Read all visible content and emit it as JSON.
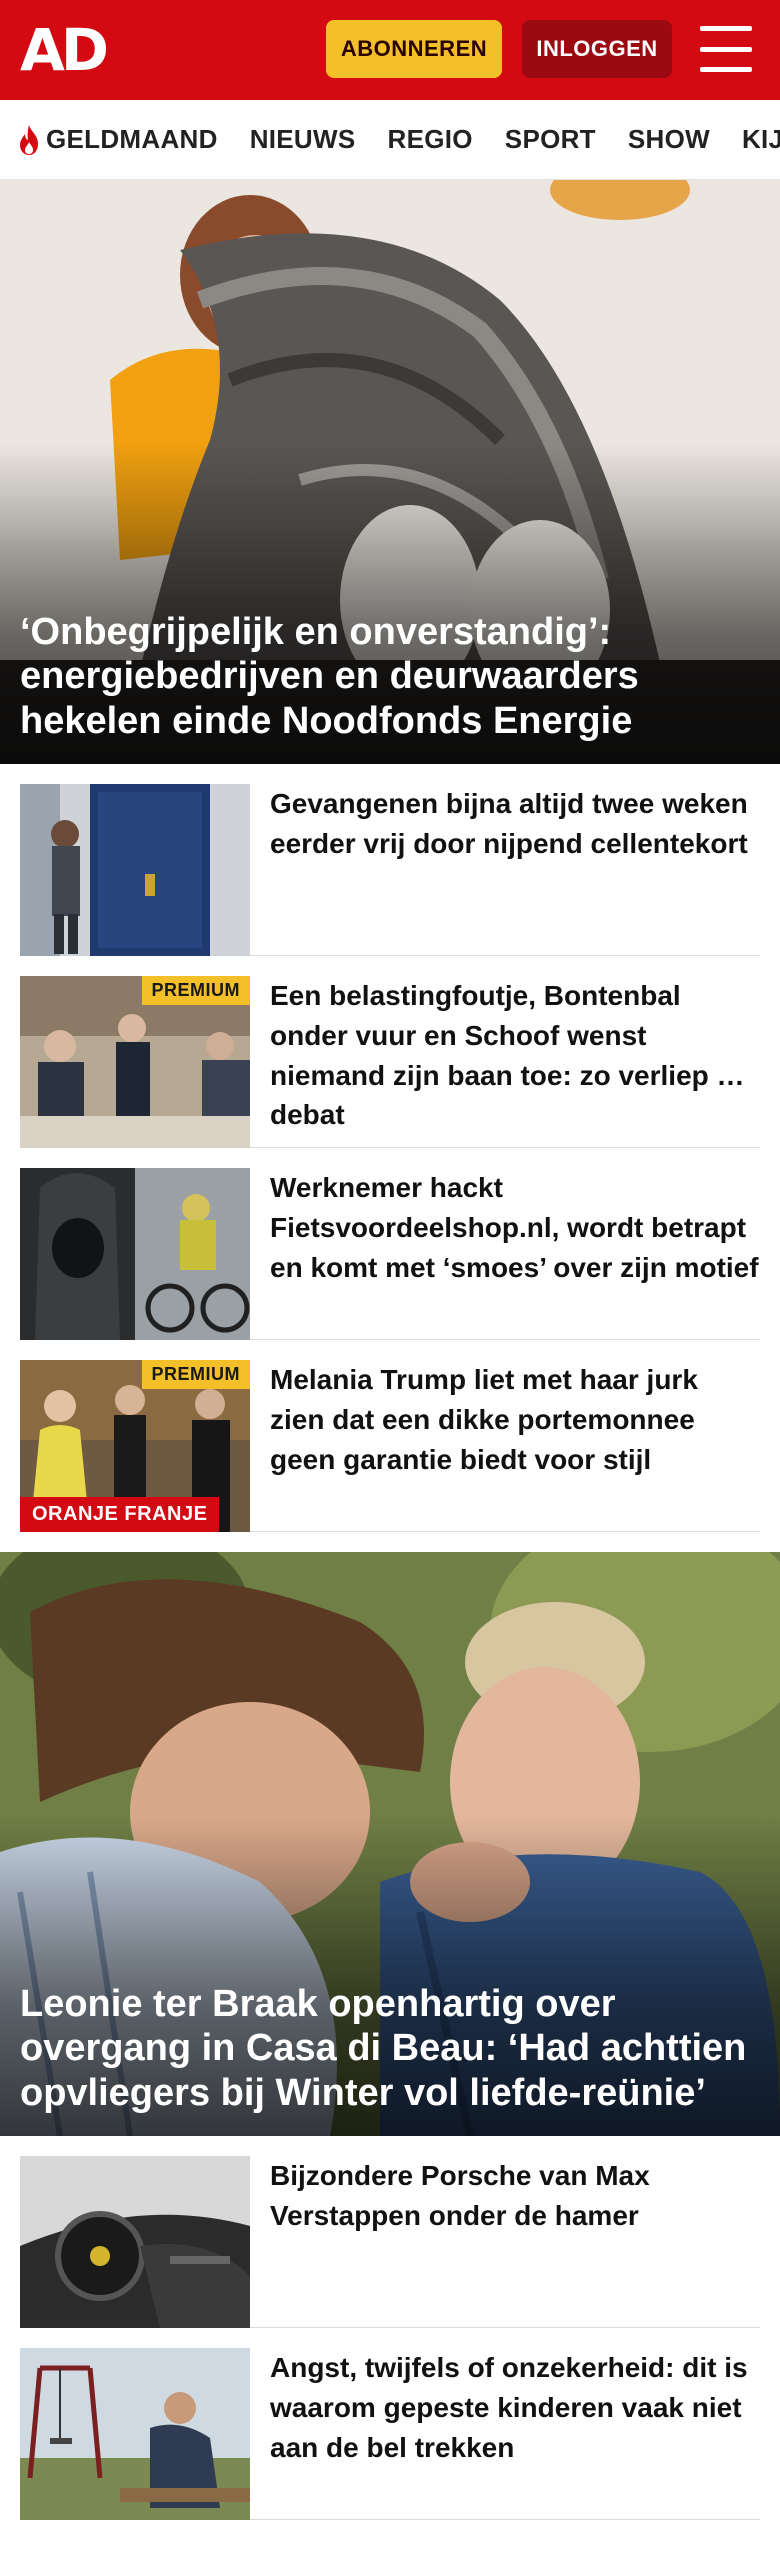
{
  "header": {
    "logo": "AD",
    "subscribe_label": "ABONNEREN",
    "login_label": "INLOGGEN"
  },
  "nav": {
    "items": [
      {
        "label": "GELDMAAND",
        "icon": "flame-icon"
      },
      {
        "label": "NIEUWS"
      },
      {
        "label": "REGIO"
      },
      {
        "label": "SPORT"
      },
      {
        "label": "SHOW"
      },
      {
        "label": "KIJK"
      }
    ]
  },
  "hero1": {
    "title": "‘Onbegrijpelijk en onverstandig’: energiebedrijven en deurwaarders hekelen einde Noodfonds Energie"
  },
  "list1": [
    {
      "title": "Gevangenen bijna altijd twee weken eerder vrij door nijpend cellentekort"
    },
    {
      "title": "Een belastingfoutje, Bontenbal onder vuur en Schoof wenst niemand zijn baan toe: zo verliep het debat",
      "badge": "PREMIUM"
    },
    {
      "title": "Werknemer hackt Fietsvoordeelshop.nl, wordt betrapt en komt met ‘smoes’ over zijn motief"
    },
    {
      "title": "Melania Trump liet met haar jurk zien dat een dikke portemonnee geen garantie biedt voor stijl",
      "badge": "PREMIUM",
      "tag": "ORANJE FRANJE"
    }
  ],
  "hero2": {
    "title": "Leonie ter Braak openhartig over overgang in Casa di Beau: ‘Had achttien opvliegers bij Winter vol liefde-reünie’"
  },
  "list2": [
    {
      "title": "Bijzondere Porsche van Max Verstappen onder de hamer"
    },
    {
      "title": "Angst, twijfels of onzekerheid: dit is waarom gepeste kinderen vaak niet aan de bel trekken"
    }
  ],
  "colors": {
    "brand_red": "#d40a12",
    "subscribe_yellow": "#f3c029",
    "login_dark_red": "#9a0a10"
  }
}
